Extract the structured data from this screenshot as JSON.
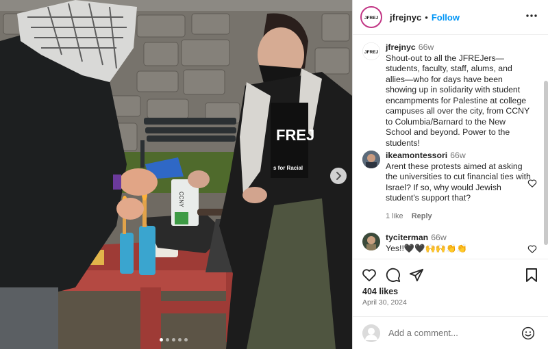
{
  "post": {
    "username": "jfrejnyc",
    "follow_label": "Follow",
    "separator": "•",
    "avatar_text": "JFREJ"
  },
  "caption": {
    "username": "jfrejnyc",
    "time": "66w",
    "text": "Shout-out to all the JFREJers—students, faculty, staff, alums, and allies—who for days have been showing up in solidarity with student encampments for Palestine at college campuses all over the city, from CCNY to Columbia/Barnard to the New School and beyond. Power to the students!"
  },
  "comments": [
    {
      "username": "ikeamontessori",
      "time": "66w",
      "text": "Arent these protests aimed at asking the universities to cut financial ties with Israel? If so, why would Jewish student's support that?",
      "likes": "1 like",
      "reply": "Reply"
    },
    {
      "username": "tyciterman",
      "time": "66w",
      "text": "Yes!!🖤🖤🙌🙌👏👏"
    }
  ],
  "likes": "404 likes",
  "date": "April 30, 2024",
  "add_comment_placeholder": "Add a comment...",
  "photo": {
    "shirt_text": "FREJ",
    "shirt_subtext": "s for Racial",
    "box_text": "CCNY",
    "carousel_count": 5,
    "carousel_active": 0
  },
  "colors": {
    "follow": "#0095f6",
    "muted": "#737373",
    "story_ring": "#c13584"
  },
  "icons": [
    "more-options-icon",
    "heart-icon",
    "comment-icon",
    "share-icon",
    "bookmark-icon",
    "emoji-icon",
    "chevron-right-icon"
  ]
}
